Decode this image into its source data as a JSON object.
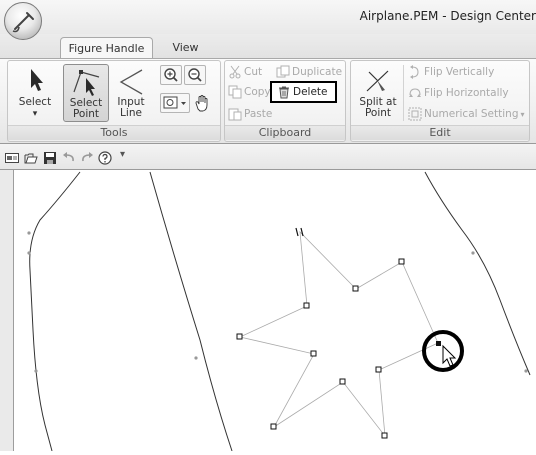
{
  "window": {
    "title": "Airplane.PEM - Design Center"
  },
  "app_menu": {
    "icon": "app-orb-icon"
  },
  "tabs": [
    {
      "label": "Figure Handle",
      "active": true
    },
    {
      "label": "View",
      "active": false
    }
  ],
  "ribbon": {
    "tools": {
      "group_label": "Tools",
      "select": {
        "line1": "Select",
        "line2": "▾"
      },
      "select_point": {
        "line1": "Select",
        "line2": "Point"
      },
      "input_line": {
        "line1": "Input",
        "line2": "Line"
      }
    },
    "clipboard": {
      "group_label": "Clipboard",
      "cut": "Cut",
      "duplicate": "Duplicate",
      "copy": "Copy",
      "delete": "Delete",
      "paste": "Paste"
    },
    "edit": {
      "group_label": "Edit",
      "split": {
        "line1": "Split at",
        "line2": "Point"
      },
      "flip_vertically": "Flip Vertically",
      "flip_horizontally": "Flip Horizontally",
      "numerical_setting": "Numerical Setting"
    }
  },
  "quick_access": {
    "icons": [
      "view-mode-icon",
      "open-folder-icon",
      "save-icon",
      "undo-icon",
      "redo-icon",
      "help-icon",
      "customize-dropdown-icon"
    ],
    "customize": "▾"
  },
  "colors": {
    "highlight_box": "#000000",
    "delete_icon": "#555555",
    "pointer_circle": "#000000",
    "ribbon_bg": "#f0f0f0",
    "selected_tool_bg": "#dcdcdc"
  }
}
